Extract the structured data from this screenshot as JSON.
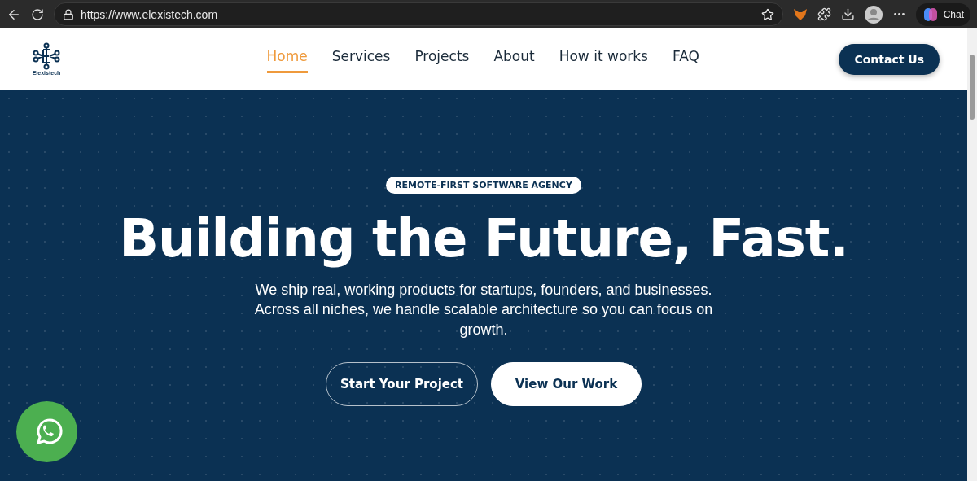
{
  "browser": {
    "url": "https://www.elexistech.com",
    "chat_label": "Chat"
  },
  "header": {
    "logo_text": "Elexistech",
    "nav": [
      {
        "label": "Home",
        "selected": true
      },
      {
        "label": "Services",
        "selected": false
      },
      {
        "label": "Projects",
        "selected": false
      },
      {
        "label": "About",
        "selected": false
      },
      {
        "label": "How it works",
        "selected": false
      },
      {
        "label": "FAQ",
        "selected": false
      }
    ],
    "cta": "Contact Us"
  },
  "hero": {
    "badge": "REMOTE-FIRST SOFTWARE AGENCY",
    "title": "Building the Future, Fast.",
    "subtitle": "We ship real, working products for startups, founders, and businesses. Across all niches, we handle scalable architecture so you can focus on growth.",
    "buttons": [
      {
        "label": "Start Your Project",
        "kind": "outline"
      },
      {
        "label": "View Our Work",
        "kind": "solid"
      }
    ]
  }
}
